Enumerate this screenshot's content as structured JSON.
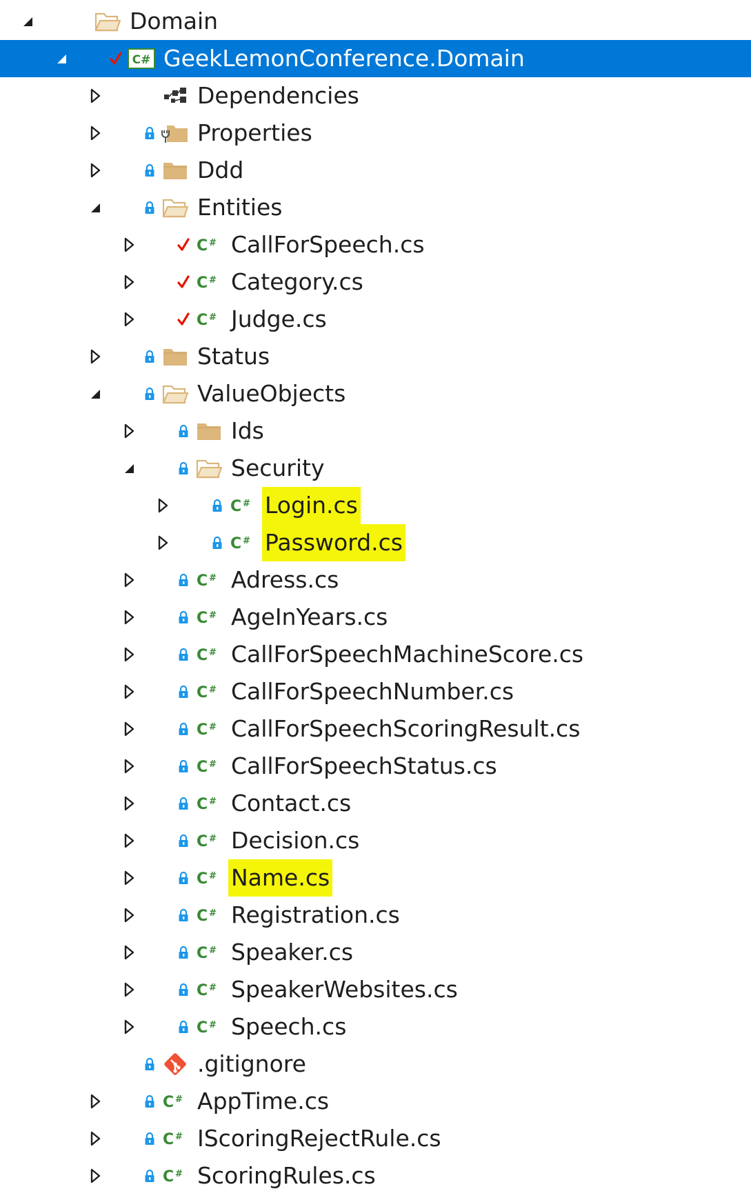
{
  "colors": {
    "selection": "#0078d7",
    "highlight": "#f5f50a",
    "csharp_green": "#388a34",
    "lock_blue": "#1c97ea",
    "check_red": "#e51400",
    "folder_tan": "#dcb67a",
    "git_orange": "#f05033"
  },
  "tree": [
    {
      "label": "Domain",
      "depth": 0,
      "arrow": "expanded",
      "status": "none",
      "icon": "folder-open-icon"
    },
    {
      "label": "GeekLemonConference.Domain",
      "depth": 1,
      "arrow": "expanded",
      "status": "check",
      "icon": "csharp-project-icon",
      "selected": true
    },
    {
      "label": "Dependencies",
      "depth": 2,
      "arrow": "collapsed",
      "status": "none",
      "icon": "dependencies-icon"
    },
    {
      "label": "Properties",
      "depth": 2,
      "arrow": "collapsed",
      "status": "lock",
      "icon": "properties-folder-icon"
    },
    {
      "label": "Ddd",
      "depth": 2,
      "arrow": "collapsed",
      "status": "lock",
      "icon": "folder-icon"
    },
    {
      "label": "Entities",
      "depth": 2,
      "arrow": "expanded",
      "status": "lock",
      "icon": "folder-open-icon"
    },
    {
      "label": "CallForSpeech.cs",
      "depth": 3,
      "arrow": "collapsed",
      "status": "check",
      "icon": "csharp-file-icon"
    },
    {
      "label": "Category.cs",
      "depth": 3,
      "arrow": "collapsed",
      "status": "check",
      "icon": "csharp-file-icon"
    },
    {
      "label": "Judge.cs",
      "depth": 3,
      "arrow": "collapsed",
      "status": "check",
      "icon": "csharp-file-icon"
    },
    {
      "label": "Status",
      "depth": 2,
      "arrow": "collapsed",
      "status": "lock",
      "icon": "folder-icon"
    },
    {
      "label": "ValueObjects",
      "depth": 2,
      "arrow": "expanded",
      "status": "lock",
      "icon": "folder-open-icon"
    },
    {
      "label": "Ids",
      "depth": 3,
      "arrow": "collapsed",
      "status": "lock",
      "icon": "folder-icon"
    },
    {
      "label": "Security",
      "depth": 3,
      "arrow": "expanded",
      "status": "lock",
      "icon": "folder-open-icon"
    },
    {
      "label": "Login.cs",
      "depth": 4,
      "arrow": "collapsed",
      "status": "lock",
      "icon": "csharp-file-icon",
      "highlight": true
    },
    {
      "label": "Password.cs",
      "depth": 4,
      "arrow": "collapsed",
      "status": "lock",
      "icon": "csharp-file-icon",
      "highlight": true
    },
    {
      "label": "Adress.cs",
      "depth": 3,
      "arrow": "collapsed",
      "status": "lock",
      "icon": "csharp-file-icon"
    },
    {
      "label": "AgeInYears.cs",
      "depth": 3,
      "arrow": "collapsed",
      "status": "lock",
      "icon": "csharp-file-icon"
    },
    {
      "label": "CallForSpeechMachineScore.cs",
      "depth": 3,
      "arrow": "collapsed",
      "status": "lock",
      "icon": "csharp-file-icon"
    },
    {
      "label": "CallForSpeechNumber.cs",
      "depth": 3,
      "arrow": "collapsed",
      "status": "lock",
      "icon": "csharp-file-icon"
    },
    {
      "label": "CallForSpeechScoringResult.cs",
      "depth": 3,
      "arrow": "collapsed",
      "status": "lock",
      "icon": "csharp-file-icon"
    },
    {
      "label": "CallForSpeechStatus.cs",
      "depth": 3,
      "arrow": "collapsed",
      "status": "lock",
      "icon": "csharp-file-icon"
    },
    {
      "label": "Contact.cs",
      "depth": 3,
      "arrow": "collapsed",
      "status": "lock",
      "icon": "csharp-file-icon"
    },
    {
      "label": "Decision.cs",
      "depth": 3,
      "arrow": "collapsed",
      "status": "lock",
      "icon": "csharp-file-icon"
    },
    {
      "label": "Name.cs",
      "depth": 3,
      "arrow": "collapsed",
      "status": "lock",
      "icon": "csharp-file-icon",
      "highlight": true
    },
    {
      "label": "Registration.cs",
      "depth": 3,
      "arrow": "collapsed",
      "status": "lock",
      "icon": "csharp-file-icon"
    },
    {
      "label": "Speaker.cs",
      "depth": 3,
      "arrow": "collapsed",
      "status": "lock",
      "icon": "csharp-file-icon"
    },
    {
      "label": "SpeakerWebsites.cs",
      "depth": 3,
      "arrow": "collapsed",
      "status": "lock",
      "icon": "csharp-file-icon"
    },
    {
      "label": "Speech.cs",
      "depth": 3,
      "arrow": "collapsed",
      "status": "lock",
      "icon": "csharp-file-icon"
    },
    {
      "label": ".gitignore",
      "depth": 2,
      "arrow": "none",
      "status": "lock",
      "icon": "git-icon"
    },
    {
      "label": "AppTime.cs",
      "depth": 2,
      "arrow": "collapsed",
      "status": "lock",
      "icon": "csharp-file-icon"
    },
    {
      "label": "IScoringRejectRule.cs",
      "depth": 2,
      "arrow": "collapsed",
      "status": "lock",
      "icon": "csharp-file-icon"
    },
    {
      "label": "ScoringRules.cs",
      "depth": 2,
      "arrow": "collapsed",
      "status": "lock",
      "icon": "csharp-file-icon"
    }
  ]
}
